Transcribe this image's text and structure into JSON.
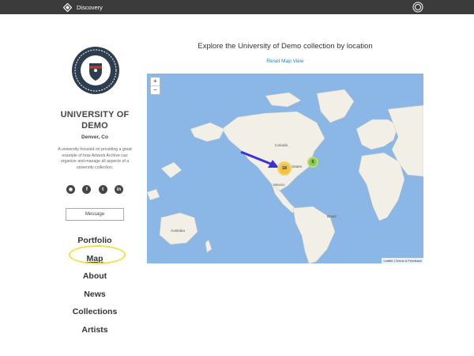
{
  "topbar": {
    "brand": "Discovery",
    "logo_icon": "archive-logo-icon",
    "user_icon": "user-avatar-icon"
  },
  "sidebar": {
    "name_line1": "UNIVERSITY OF",
    "name_line2": "DEMO",
    "location": "Denver, Co",
    "description": "A university focused on providing a great example of how Artwork Archive can organize and manage all aspects of a university collection.",
    "social": [
      {
        "icon": "globe-icon",
        "glyph": "◉"
      },
      {
        "icon": "facebook-icon",
        "glyph": "f"
      },
      {
        "icon": "twitter-icon",
        "glyph": "t"
      },
      {
        "icon": "linkedin-icon",
        "glyph": "in"
      }
    ],
    "message_label": "Message",
    "nav": [
      {
        "label": "Portfolio",
        "active": false
      },
      {
        "label": "Map",
        "active": true
      },
      {
        "label": "About",
        "active": false
      },
      {
        "label": "News",
        "active": false
      },
      {
        "label": "Collections",
        "active": false
      },
      {
        "label": "Artists",
        "active": false
      }
    ]
  },
  "main": {
    "title": "Explore the University of Demo collection by location",
    "reset_label": "Reset Map View",
    "zoom_in": "+",
    "zoom_out": "−",
    "clusters": [
      {
        "count": "18",
        "color": "#f1d16a",
        "inner": "#f0c23d"
      },
      {
        "count": "5",
        "color": "#b5dd7a",
        "inner": "#8cc94f"
      }
    ],
    "labels": {
      "canada": "Canada",
      "states": "States",
      "mexico": "Mexico",
      "brasil": "Brasil",
      "australia": "Australia"
    },
    "attribution": "Leaflet | Terms & Feedback",
    "arrow_color": "#3a32d9"
  }
}
